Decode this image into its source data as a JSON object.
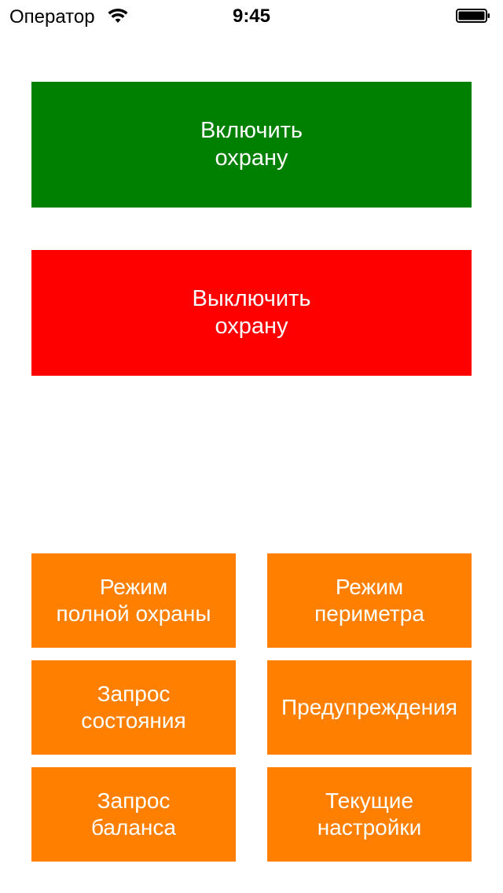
{
  "status_bar": {
    "carrier": "Оператор",
    "time": "9:45",
    "wifi_icon": "wifi-icon",
    "battery_icon": "battery-icon"
  },
  "colors": {
    "arm": "#008000",
    "disarm": "#ff0000",
    "action": "#ff8000",
    "background": "#ffffff",
    "text": "#ffffff"
  },
  "main": {
    "arm_button": {
      "line1": "Включить",
      "line2": "охрану"
    },
    "disarm_button": {
      "line1": "Выключить",
      "line2": "охрану"
    }
  },
  "actions": {
    "full_mode": {
      "line1": "Режим",
      "line2": "полной охраны"
    },
    "perimeter_mode": {
      "line1": "Режим",
      "line2": "периметра"
    },
    "status_request": {
      "line1": "Запрос",
      "line2": "состояния"
    },
    "warnings": {
      "line1": "Предупреждения"
    },
    "balance_request": {
      "line1": "Запрос",
      "line2": "баланса"
    },
    "current_settings": {
      "line1": "Текущие",
      "line2": "настройки"
    }
  }
}
